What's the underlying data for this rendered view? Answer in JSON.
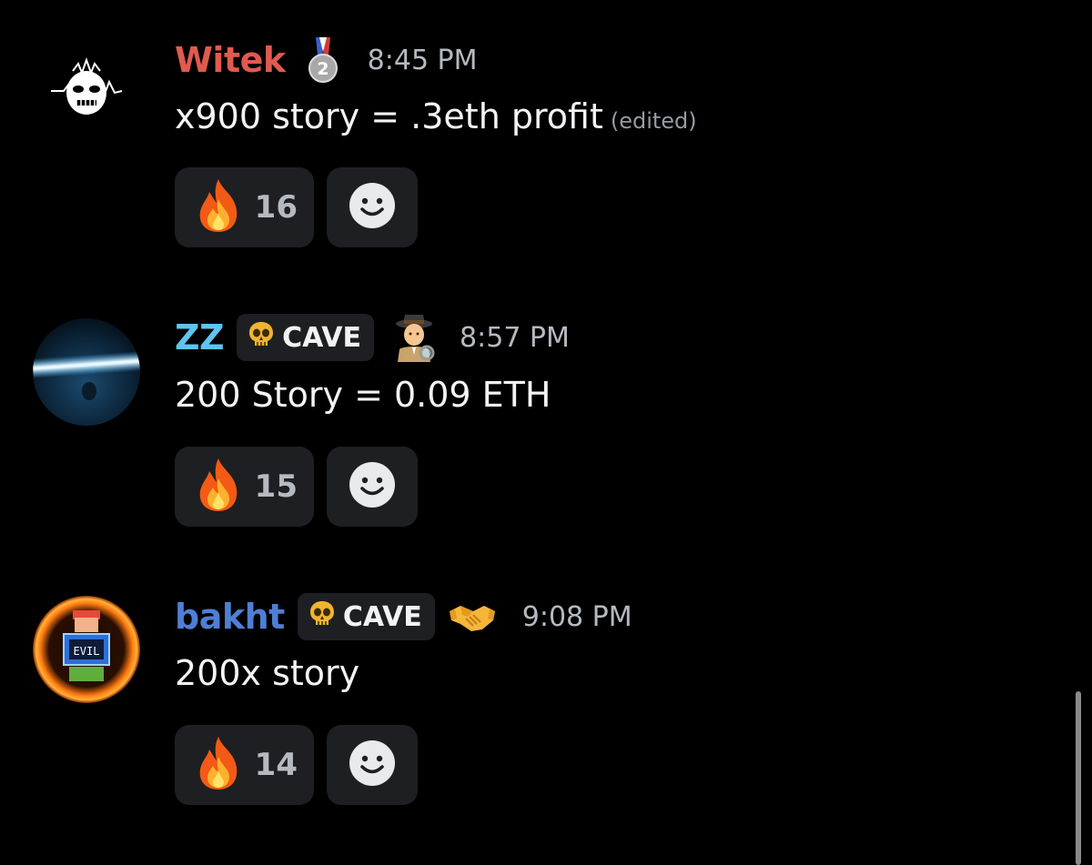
{
  "messages": [
    {
      "username": "Witek",
      "username_color": "#e05a4f",
      "header_icon": "silver-medal-2-icon",
      "timestamp": "8:45 PM",
      "content": "x900 story = .3eth profit",
      "edited_label": "(edited)",
      "reaction": {
        "emoji": "fire-icon",
        "count": "16"
      },
      "avatar": "dark-mask-logo"
    },
    {
      "username": "ZZ",
      "username_color": "#5fc4f2",
      "role_badge": {
        "icon": "skull-icon",
        "label": "CAVE"
      },
      "header_icon": "detective-icon",
      "timestamp": "8:57 PM",
      "content": "200 Story = 0.09 ETH",
      "reaction": {
        "emoji": "fire-icon",
        "count": "15"
      },
      "avatar": "blue-light-beam"
    },
    {
      "username": "bakht",
      "username_color": "#4f7fd4",
      "role_badge": {
        "icon": "skull-icon",
        "label": "CAVE"
      },
      "header_icon": "handshake-icon",
      "timestamp": "9:08 PM",
      "content": "200x story",
      "reaction": {
        "emoji": "fire-icon",
        "count": "14"
      },
      "avatar": "pixel-evil-character-fire-ring"
    }
  ],
  "add_reaction_icon": "smiley-face-icon"
}
